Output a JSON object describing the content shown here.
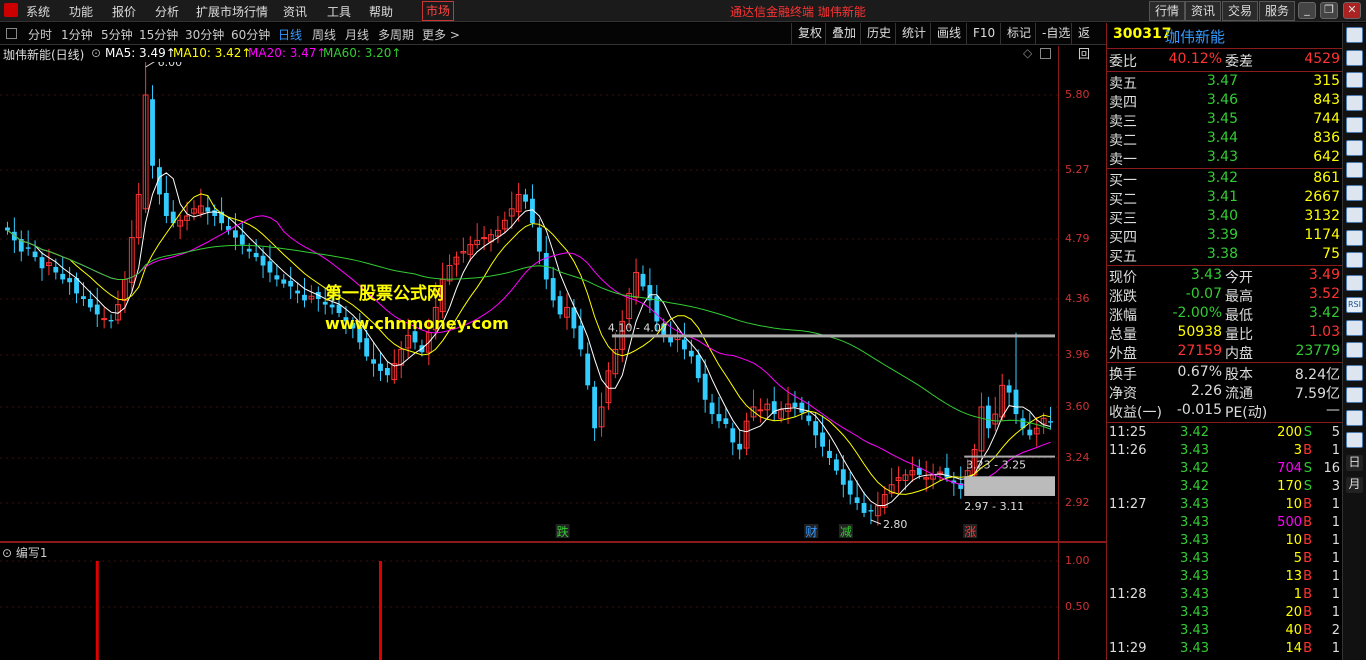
{
  "menu": {
    "items": [
      "系统",
      "功能",
      "报价",
      "分析",
      "扩展市场行情",
      "资讯",
      "工具",
      "帮助"
    ],
    "market": "市场",
    "center_title": "通达信金融终端  珈伟新能",
    "tabs": [
      "行情",
      "资讯",
      "交易",
      "服务"
    ]
  },
  "periods": [
    "分时",
    "1分钟",
    "5分钟",
    "15分钟",
    "30分钟",
    "60分钟",
    "日线",
    "周线",
    "月线",
    "多周期",
    "更多 >"
  ],
  "active_period": "日线",
  "toolbar_right": [
    "复权",
    "叠加",
    "历史",
    "统计",
    "画线",
    "F10",
    "标记",
    "-自选",
    "返回"
  ],
  "chart": {
    "name": "珈伟新能(日线)",
    "ma5": "MA5: 3.49↑",
    "ma10": "MA10: 3.42↑",
    "ma20": "MA20: 3.47↑",
    "ma60": "MA60: 3.20↑",
    "price_ticks": [
      "5.80",
      "5.27",
      "4.79",
      "4.36",
      "3.96",
      "3.60",
      "3.24",
      "2.92"
    ],
    "high_label": "6.00",
    "low_label": "2.80",
    "box1": "4.10 - 4.07",
    "box2": "3.23 - 3.25",
    "box3": "2.97 - 3.11",
    "markers": [
      {
        "text": "跌",
        "color": "#3c3"
      },
      {
        "text": "财",
        "color": "#39f"
      },
      {
        "text": "减",
        "color": "#3c3"
      },
      {
        "text": "涨",
        "color": "#f33"
      }
    ],
    "closes": [
      4.85,
      4.78,
      4.7,
      4.72,
      4.66,
      4.58,
      4.62,
      4.55,
      4.5,
      4.48,
      4.4,
      4.36,
      4.3,
      4.25,
      4.22,
      4.2,
      4.32,
      4.5,
      4.8,
      5.1,
      5.8,
      5.3,
      5.1,
      4.95,
      4.9,
      4.92,
      4.95,
      5.0,
      5.02,
      4.98,
      4.95,
      4.9,
      4.85,
      4.8,
      4.75,
      4.7,
      4.66,
      4.6,
      4.55,
      4.5,
      4.47,
      4.45,
      4.4,
      4.35,
      4.38,
      4.36,
      4.32,
      4.3,
      4.26,
      4.2,
      4.15,
      4.05,
      3.95,
      3.9,
      3.85,
      3.82,
      3.9,
      4.0,
      4.1,
      4.05,
      3.98,
      4.12,
      4.3,
      4.5,
      4.6,
      4.66,
      4.7,
      4.75,
      4.78,
      4.8,
      4.82,
      4.85,
      4.92,
      5.0,
      5.1,
      5.05,
      4.9,
      4.7,
      4.5,
      4.35,
      4.25,
      4.3,
      4.15,
      4.0,
      3.75,
      3.45,
      3.6,
      3.85,
      4.0,
      4.2,
      4.4,
      4.55,
      4.45,
      4.35,
      4.2,
      4.1,
      4.05,
      4.1,
      4.0,
      3.95,
      3.8,
      3.65,
      3.55,
      3.5,
      3.48,
      3.35,
      3.3,
      3.5,
      3.6,
      3.58,
      3.62,
      3.55,
      3.58,
      3.62,
      3.6,
      3.56,
      3.5,
      3.4,
      3.32,
      3.24,
      3.15,
      3.05,
      2.98,
      2.92,
      2.85,
      2.86,
      2.9,
      2.98,
      3.05,
      3.1,
      3.12,
      3.15,
      3.12,
      3.1,
      3.12,
      3.14,
      3.1,
      3.06,
      3.02,
      3.15,
      3.3,
      3.6,
      3.45,
      3.55,
      3.75,
      3.7,
      3.55,
      3.45,
      3.4,
      3.45,
      3.52,
      3.49
    ]
  },
  "indicator": {
    "name": "编写1",
    "ticks": [
      "1.00",
      "0.50"
    ]
  },
  "quote": {
    "code": "300317",
    "name": "珈伟新能",
    "weibi_label": "委比",
    "weibi": "40.12%",
    "weicha_label": "委差",
    "weicha": "4529",
    "asks": [
      {
        "label": "卖五",
        "price": "3.47",
        "vol": "315"
      },
      {
        "label": "卖四",
        "price": "3.46",
        "vol": "843"
      },
      {
        "label": "卖三",
        "price": "3.45",
        "vol": "744"
      },
      {
        "label": "卖二",
        "price": "3.44",
        "vol": "836"
      },
      {
        "label": "卖一",
        "price": "3.43",
        "vol": "642"
      }
    ],
    "bids": [
      {
        "label": "买一",
        "price": "3.42",
        "vol": "861"
      },
      {
        "label": "买二",
        "price": "3.41",
        "vol": "2667"
      },
      {
        "label": "买三",
        "price": "3.40",
        "vol": "3132"
      },
      {
        "label": "买四",
        "price": "3.39",
        "vol": "1174"
      },
      {
        "label": "买五",
        "price": "3.38",
        "vol": "75"
      }
    ],
    "stats": [
      {
        "l1": "现价",
        "v1": "3.43",
        "c1": "#3c3",
        "l2": "今开",
        "v2": "3.49",
        "c2": "#f33"
      },
      {
        "l1": "涨跌",
        "v1": "-0.07",
        "c1": "#3c3",
        "l2": "最高",
        "v2": "3.52",
        "c2": "#f33"
      },
      {
        "l1": "涨幅",
        "v1": "-2.00%",
        "c1": "#3c3",
        "l2": "最低",
        "v2": "3.42",
        "c2": "#3c3"
      },
      {
        "l1": "总量",
        "v1": "50938",
        "c1": "#ff0",
        "l2": "量比",
        "v2": "1.03",
        "c2": "#f33"
      },
      {
        "l1": "外盘",
        "v1": "27159",
        "c1": "#f33",
        "l2": "内盘",
        "v2": "23779",
        "c2": "#3c3"
      }
    ],
    "fund": [
      {
        "l1": "换手",
        "v1": "0.67%",
        "l2": "股本",
        "v2": "8.24亿"
      },
      {
        "l1": "净资",
        "v1": "2.26",
        "l2": "流通",
        "v2": "7.59亿"
      },
      {
        "l1": "收益(一)",
        "v1": "-0.015",
        "l2": "PE(动)",
        "v2": "—"
      }
    ],
    "ticks": [
      {
        "time": "11:25",
        "price": "3.42",
        "vol": "200",
        "vc": "#ff0",
        "bs": "S",
        "n": "5"
      },
      {
        "time": "11:26",
        "price": "3.43",
        "vol": "3",
        "vc": "#ff0",
        "bs": "B",
        "n": "1"
      },
      {
        "time": "",
        "price": "3.42",
        "vol": "704",
        "vc": "#f0f",
        "bs": "S",
        "n": "16"
      },
      {
        "time": "",
        "price": "3.42",
        "vol": "170",
        "vc": "#ff0",
        "bs": "S",
        "n": "3"
      },
      {
        "time": "11:27",
        "price": "3.43",
        "vol": "10",
        "vc": "#ff0",
        "bs": "B",
        "n": "1"
      },
      {
        "time": "",
        "price": "3.43",
        "vol": "500",
        "vc": "#f0f",
        "bs": "B",
        "n": "1"
      },
      {
        "time": "",
        "price": "3.43",
        "vol": "10",
        "vc": "#ff0",
        "bs": "B",
        "n": "1"
      },
      {
        "time": "",
        "price": "3.43",
        "vol": "5",
        "vc": "#ff0",
        "bs": "B",
        "n": "1"
      },
      {
        "time": "",
        "price": "3.43",
        "vol": "13",
        "vc": "#ff0",
        "bs": "B",
        "n": "1"
      },
      {
        "time": "11:28",
        "price": "3.43",
        "vol": "1",
        "vc": "#ff0",
        "bs": "B",
        "n": "1"
      },
      {
        "time": "",
        "price": "3.43",
        "vol": "20",
        "vc": "#ff0",
        "bs": "B",
        "n": "1"
      },
      {
        "time": "",
        "price": "3.43",
        "vol": "40",
        "vc": "#ff0",
        "bs": "B",
        "n": "2"
      },
      {
        "time": "11:29",
        "price": "3.43",
        "vol": "14",
        "vc": "#ff0",
        "bs": "B",
        "n": "1"
      }
    ]
  },
  "watermark": {
    "line1": "第一股票公式网",
    "line2": "www.chnmoney.com"
  },
  "side_icons": [
    "ICON",
    "ICON",
    "ICON",
    "ICON",
    "ICON",
    "ICON",
    "ICON",
    "ICON",
    "ICON",
    "ICON",
    "ICON",
    "ICON",
    "RSI",
    "ICON",
    "ICON",
    "ICON",
    "ICON",
    "ICON",
    "ICON",
    "日",
    "月"
  ],
  "colors": {
    "up": "#f33",
    "down": "#3cf",
    "ma5": "#fff",
    "ma10": "#ff0",
    "ma20": "#f0f",
    "ma60": "#3c3",
    "axis": "#8b1a1a"
  }
}
